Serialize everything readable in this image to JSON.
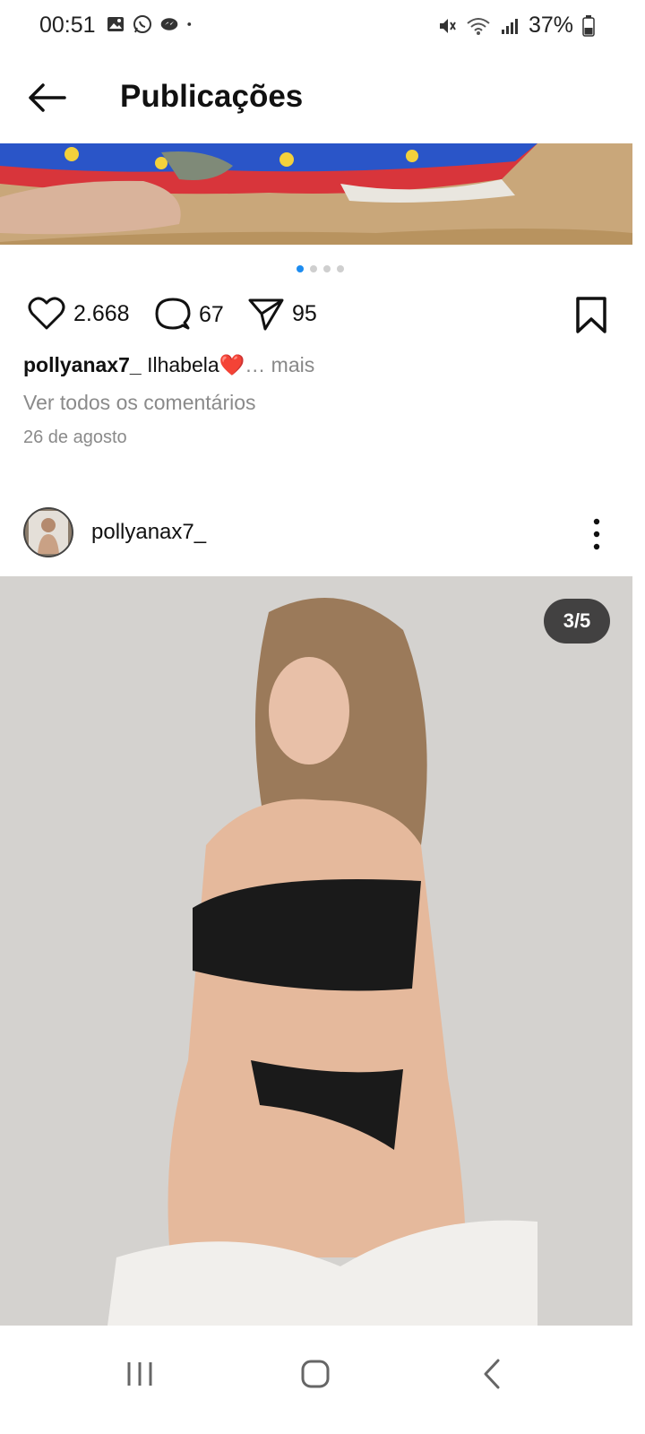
{
  "status_bar": {
    "time": "00:51",
    "battery": "37%",
    "notification_icons": [
      "gallery-icon",
      "whatsapp-icon",
      "messenger-icon",
      "dot-icon"
    ],
    "system_icons": [
      "mute-icon",
      "wifi-icon",
      "signal-icon",
      "battery-icon"
    ]
  },
  "app_bar": {
    "title": "Publicações",
    "back_icon": "arrow-left-icon"
  },
  "post_previous": {
    "carousel_dots": 4,
    "carousel_active_index": 0,
    "likes": "2.668",
    "comments": "67",
    "shares": "95",
    "caption_user": "pollyanax7_",
    "caption_text": "Ilhabela❤️",
    "caption_more": "… mais",
    "view_comments": "Ver todos os comentários",
    "date": "26 de agosto"
  },
  "post_current": {
    "username": "pollyanax7_",
    "counter": "3/5"
  },
  "colors": {
    "accent": "#1d8cf0",
    "text_secondary": "#8a8a8a",
    "photo_bg": "#d3d3d3"
  },
  "nav_bar": {
    "buttons": [
      "recents-icon",
      "home-icon",
      "back-icon"
    ]
  }
}
